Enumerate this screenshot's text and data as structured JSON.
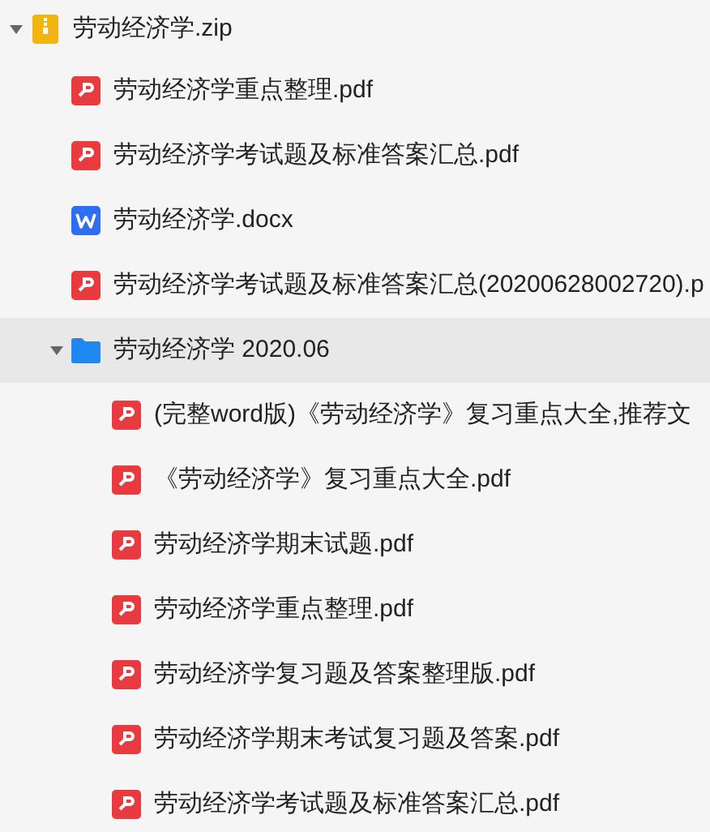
{
  "tree": [
    {
      "kind": "zip",
      "name": "劳动经济学.zip",
      "expanded": true,
      "selected": false,
      "children": [
        {
          "kind": "pdf",
          "name": "劳动经济学重点整理.pdf",
          "selected": false
        },
        {
          "kind": "pdf",
          "name": "劳动经济学考试题及标准答案汇总.pdf",
          "selected": false
        },
        {
          "kind": "docx",
          "name": "劳动经济学.docx",
          "selected": false
        },
        {
          "kind": "pdf",
          "name": "劳动经济学考试题及标准答案汇总(20200628002720).p",
          "selected": false
        },
        {
          "kind": "folder",
          "name": "劳动经济学 2020.06",
          "expanded": true,
          "selected": true,
          "children": [
            {
              "kind": "pdf",
              "name": "(完整word版)《劳动经济学》复习重点大全,推荐文",
              "selected": false
            },
            {
              "kind": "pdf",
              "name": "《劳动经济学》复习重点大全.pdf",
              "selected": false
            },
            {
              "kind": "pdf",
              "name": "劳动经济学期末试题.pdf",
              "selected": false
            },
            {
              "kind": "pdf",
              "name": "劳动经济学重点整理.pdf",
              "selected": false
            },
            {
              "kind": "pdf",
              "name": "劳动经济学复习题及答案整理版.pdf",
              "selected": false
            },
            {
              "kind": "pdf",
              "name": "劳动经济学期末考试复习题及答案.pdf",
              "selected": false
            },
            {
              "kind": "pdf",
              "name": "劳动经济学考试题及标准答案汇总.pdf",
              "selected": false
            }
          ]
        }
      ]
    }
  ]
}
